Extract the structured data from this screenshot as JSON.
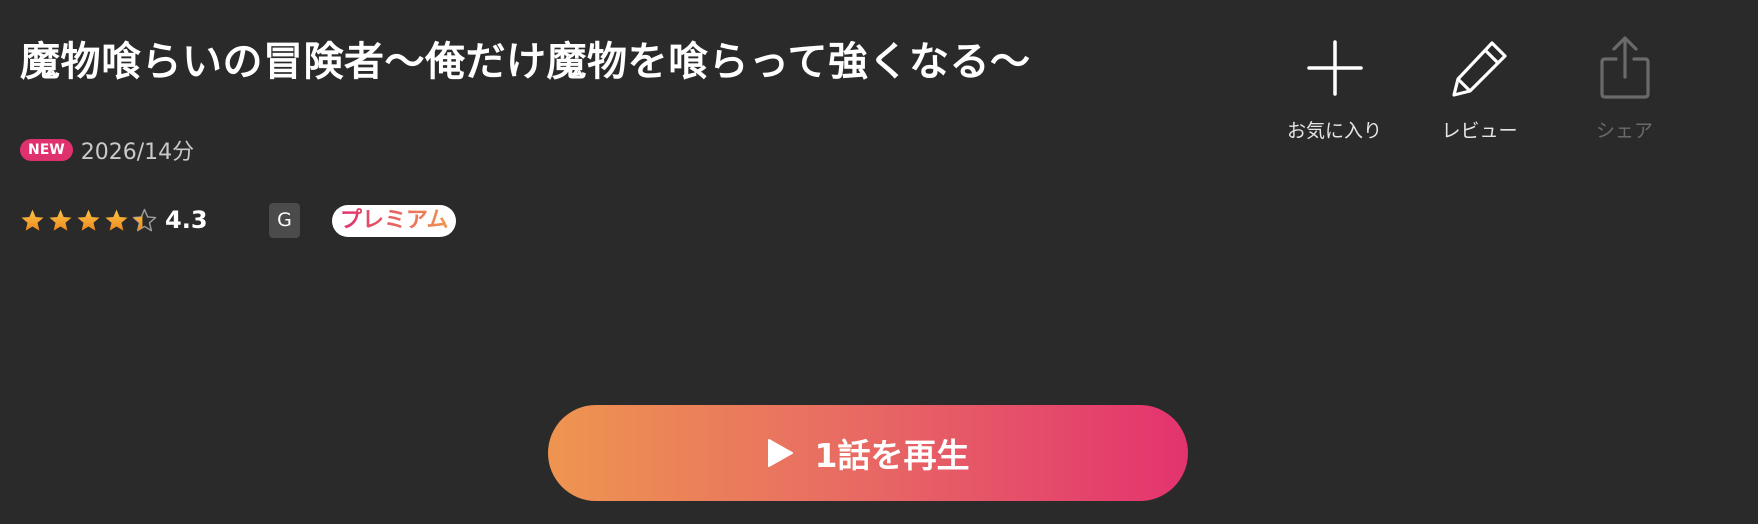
{
  "title": "魔物喰らいの冒険者〜俺だけ魔物を喰らって強くなる〜",
  "meta": {
    "new_badge": "NEW",
    "year_duration": "2026/14分"
  },
  "rating": {
    "value": "4.3",
    "stars_filled": 4.3,
    "stars_max": 5,
    "star_color": "#f5a623"
  },
  "age_rating": "G",
  "premium_label": "プレミアム",
  "actions": {
    "favorite": {
      "label": "お気に入り",
      "icon": "plus-icon"
    },
    "review": {
      "label": "レビュー",
      "icon": "pencil-icon"
    },
    "share": {
      "label": "シェア",
      "icon": "share-icon",
      "disabled": true
    }
  },
  "play_button": {
    "label": "1話を再生",
    "icon": "play-icon"
  },
  "colors": {
    "background": "#2a2a2a",
    "accent_pink": "#e0316f",
    "accent_orange": "#ee9550",
    "muted_gray": "#6a6a6a"
  }
}
